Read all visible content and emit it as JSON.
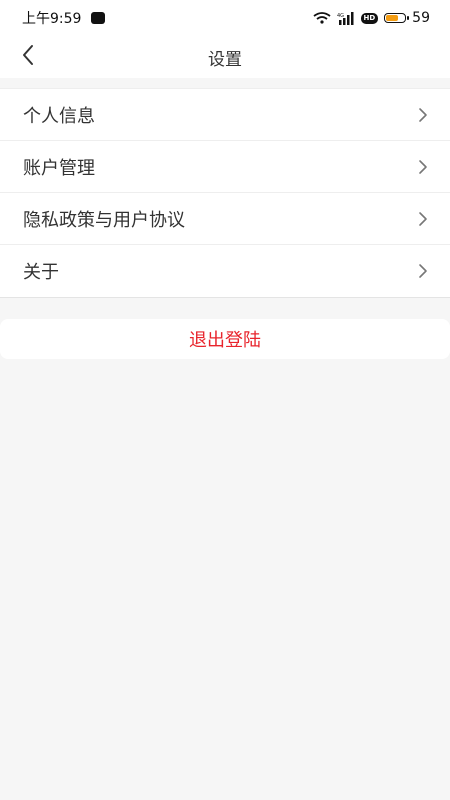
{
  "status_bar": {
    "time": "上午9:59",
    "battery_level": "59",
    "battery_fill_fraction": 0.59,
    "network_label": "4G",
    "hd_label": "HD",
    "battery_color": "#f39c12"
  },
  "header": {
    "title": "设置",
    "back_icon": "chevron-left-icon"
  },
  "menu": {
    "items": [
      {
        "label": "个人信息",
        "icon": "chevron-right-icon"
      },
      {
        "label": "账户管理",
        "icon": "chevron-right-icon"
      },
      {
        "label": "隐私政策与用户协议",
        "icon": "chevron-right-icon"
      },
      {
        "label": "关于",
        "icon": "chevron-right-icon"
      }
    ]
  },
  "logout": {
    "label": "退出登陆",
    "color": "#e8242c"
  },
  "colors": {
    "background": "#f6f6f6",
    "surface": "#ffffff",
    "text": "#333333"
  }
}
